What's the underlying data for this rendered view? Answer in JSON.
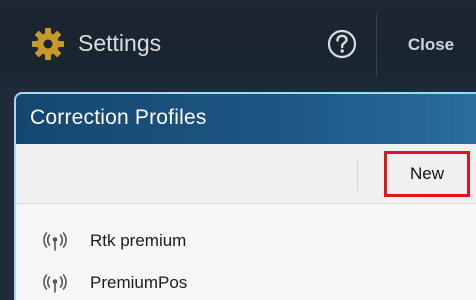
{
  "topbar": {
    "title": "Settings",
    "close_label": "Close",
    "icons": {
      "settings": "gear-icon",
      "help": "question-circle-icon"
    },
    "colors": {
      "gear": "#c79a2a",
      "background": "#1b2531"
    }
  },
  "panel": {
    "title": "Correction Profiles",
    "new_label": "New",
    "items": [
      {
        "label": "Rtk premium",
        "icon": "antenna-signal-icon"
      },
      {
        "label": "PremiumPos",
        "icon": "antenna-signal-icon"
      }
    ],
    "colors": {
      "header": "#1d5684",
      "highlight": "#e0141a"
    }
  }
}
